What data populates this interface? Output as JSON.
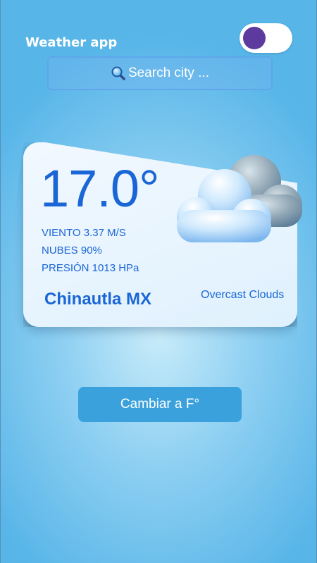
{
  "header": {
    "title": "Weather app",
    "theme_toggle": {
      "state": "on",
      "knob_color": "#5d3a9e"
    }
  },
  "search": {
    "placeholder": "Search city ...",
    "icon": "magnifying-glass-icon"
  },
  "weather": {
    "temperature": "17.0°",
    "wind": "VIENTO 3.37 M/S",
    "clouds": "NUBES 90%",
    "pressure": "PRESIÓN 1013 HPa",
    "city": "Chinautla MX",
    "description": "Overcast Clouds",
    "icon": "cloud-icon"
  },
  "actions": {
    "convert_label": "Cambiar a F°"
  },
  "colors": {
    "primary_text": "#1a66d6",
    "button_bg": "#3aa1dc",
    "background": "#57b5e8"
  }
}
